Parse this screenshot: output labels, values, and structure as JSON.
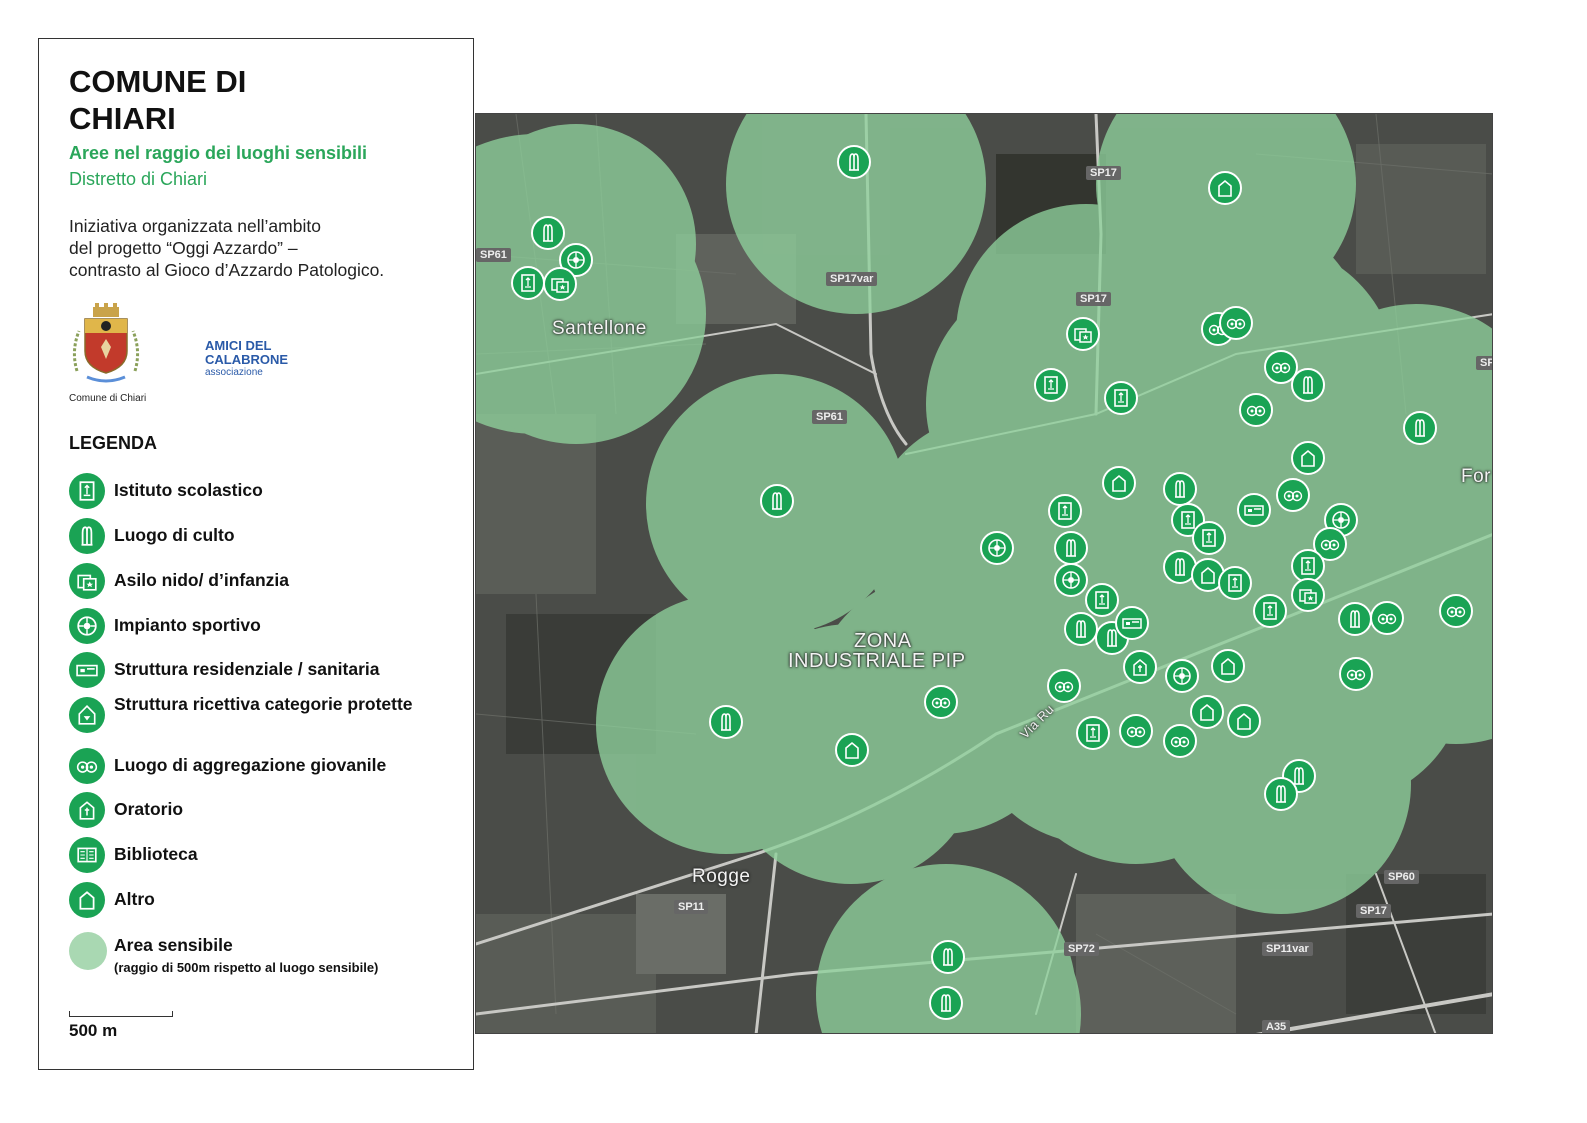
{
  "panel": {
    "title": "COMUNE DI\nCHIARI",
    "subtitle": "Aree nel raggio dei luoghi sensibili",
    "district": "Distretto di Chiari",
    "description": "Iniziativa organizzata nell’ambito\ndel progetto “Oggi Azzardo” –\ncontrasto al Gioco d’Azzardo Patologico.",
    "logo_comune_caption": "Comune di Chiari",
    "logo_amici": {
      "line1": "AMICI DEL",
      "line2": "CALABRONE",
      "line3": "associazione"
    }
  },
  "legend": {
    "title": "LEGENDA",
    "items": [
      {
        "key": "school",
        "label": "Istituto scolastico",
        "icon": "school-icon"
      },
      {
        "key": "church",
        "label": "Luogo di culto",
        "icon": "praying-hands-icon"
      },
      {
        "key": "nursery",
        "label": "Asilo nido/ d’infanzia",
        "icon": "nursery-icon"
      },
      {
        "key": "sport",
        "label": "Impianto sportivo",
        "icon": "sports-ball-icon"
      },
      {
        "key": "health",
        "label": "Struttura residenziale / sanitaria",
        "icon": "bed-icon"
      },
      {
        "key": "shelter",
        "label": "Struttura ricettiva categorie protette",
        "icon": "shelter-icon"
      },
      {
        "key": "youth",
        "label": "Luogo di aggregazione giovanile",
        "icon": "youth-faces-icon"
      },
      {
        "key": "oratory",
        "label": "Oratorio",
        "icon": "oratory-icon"
      },
      {
        "key": "library",
        "label": "Biblioteca",
        "icon": "book-icon"
      },
      {
        "key": "other",
        "label": "Altro",
        "icon": "house-icon"
      }
    ],
    "area": {
      "label": "Area sensibile",
      "sublabel": "(raggio di 500m rispetto al luogo sensibile)"
    },
    "scale": "500 m"
  },
  "map": {
    "place_labels": [
      {
        "text": "Santellone"
      },
      {
        "text": "ZONA"
      },
      {
        "text": "INDUSTRIALE PIP"
      },
      {
        "text": "Rogge"
      },
      {
        "text": "For"
      },
      {
        "text": "Via Ru"
      }
    ],
    "road_tags": [
      "SP17",
      "SP61",
      "SP17var",
      "SP17",
      "SP61",
      "SP11",
      "SP60",
      "SP17",
      "SP72",
      "SP11var",
      "A35",
      "SP"
    ],
    "colors": {
      "pin": "#1aa354",
      "area": "#8fd19c",
      "accent": "#2aa65a"
    }
  }
}
